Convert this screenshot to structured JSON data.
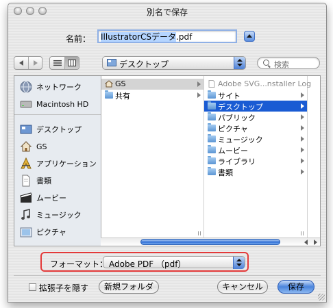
{
  "window": {
    "title": "別名で保存"
  },
  "name_row": {
    "label": "名前：",
    "filename": "IllustratorCSデータ.pdf",
    "filename_selected": "IllustratorCSデータ",
    "filename_ext": ".pdf"
  },
  "toolbar": {
    "location": "デスクトップ",
    "search_placeholder": "検索"
  },
  "sidebar": {
    "devices": [
      {
        "label": "ネットワーク",
        "icon": "network-globe-icon"
      },
      {
        "label": "Macintosh HD",
        "icon": "hard-drive-icon"
      }
    ],
    "places": [
      {
        "label": "デスクトップ",
        "icon": "desktop-icon"
      },
      {
        "label": "GS",
        "icon": "home-icon"
      },
      {
        "label": "アプリケーション",
        "icon": "applications-icon"
      },
      {
        "label": "書類",
        "icon": "documents-icon"
      },
      {
        "label": "ムービー",
        "icon": "movies-icon"
      },
      {
        "label": "ミュージック",
        "icon": "music-icon"
      },
      {
        "label": "ピクチャ",
        "icon": "pictures-icon"
      }
    ]
  },
  "columns": {
    "col1": [
      {
        "label": "GS",
        "selected": true
      },
      {
        "label": "共有"
      }
    ],
    "col2": [
      {
        "label": "Adobe SVG...nstaller Log",
        "dimmed": true
      },
      {
        "label": "サイト"
      },
      {
        "label": "デスクトップ",
        "selected": true
      },
      {
        "label": "パブリック"
      },
      {
        "label": "ピクチャ"
      },
      {
        "label": "ミュージック"
      },
      {
        "label": "ムービー"
      },
      {
        "label": "ライブラリ"
      },
      {
        "label": "書類"
      }
    ]
  },
  "format": {
    "label": "フォーマット：",
    "value": "Adobe PDF （pdf）"
  },
  "footer": {
    "hide_extension_label": "拡張子を隠す",
    "new_folder_label": "新規フォルダ",
    "cancel_label": "キャンセル",
    "save_label": "保存"
  },
  "colors": {
    "selection": "#1a5bd3",
    "highlight_ring": "#e43a3a",
    "primary_button": "#4a84dc"
  }
}
